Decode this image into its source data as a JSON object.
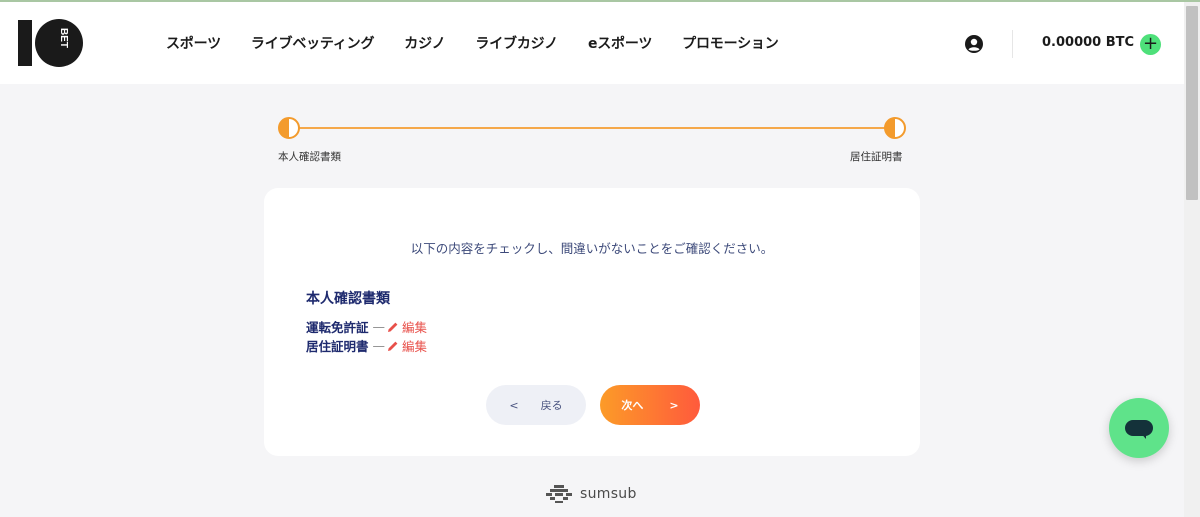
{
  "header": {
    "logo": {
      "top": "10",
      "bottom": "BET"
    },
    "nav": [
      "スポーツ",
      "ライブベッティング",
      "カジノ",
      "ライブカジノ",
      "eスポーツ",
      "プロモーション"
    ],
    "balance": "0.00000 BTC",
    "add_symbol": "+"
  },
  "progress": {
    "step1": "本人確認書類",
    "step2": "居住証明書"
  },
  "card": {
    "instruction": "以下の内容をチェックし、間違いがないことをご確認ください。",
    "section_title": "本人確認書類",
    "documents": [
      {
        "name": "運転免許証",
        "dash": "—",
        "edit": "編集"
      },
      {
        "name": "居住証明書",
        "dash": "—",
        "edit": "編集"
      }
    ],
    "back_arrow": "<",
    "back_label": "戻る",
    "next_label": "次へ",
    "next_arrow": ">"
  },
  "footer": {
    "brand": "sumsub"
  },
  "colors": {
    "accent": "#f39b2d",
    "edit": "#e8504a",
    "text_navy": "#1e2a6e",
    "chat": "#5fe38a"
  },
  "icons": [
    "user-icon",
    "add-icon",
    "pencil-icon",
    "chat-icon",
    "sumsub-logo-icon"
  ]
}
